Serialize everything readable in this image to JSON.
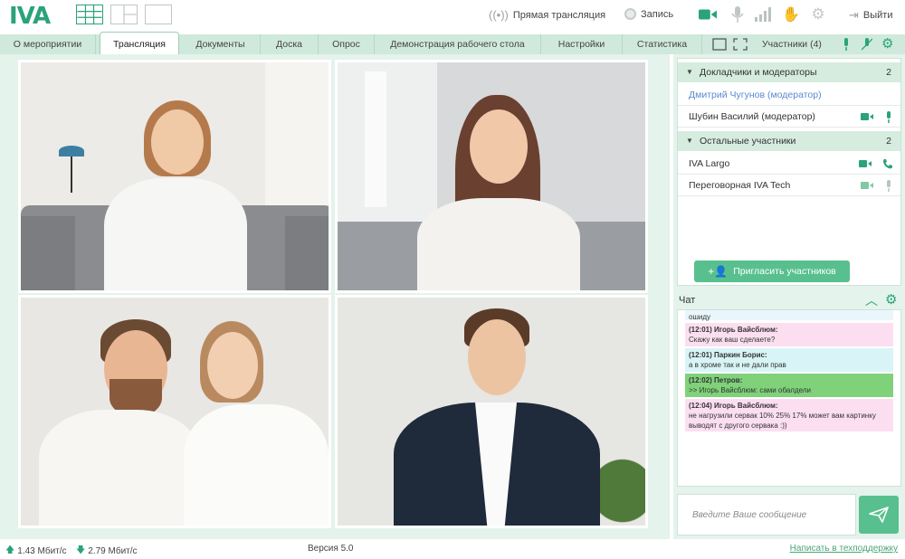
{
  "app": {
    "logo": "IVA"
  },
  "topbar": {
    "live_label": "Прямая трансляция",
    "record_label": "Запись",
    "exit_label": "Выйти"
  },
  "tabs": [
    {
      "label": "О мероприятии"
    },
    {
      "label": "Трансляция",
      "active": true
    },
    {
      "label": "Документы"
    },
    {
      "label": "Доска"
    },
    {
      "label": "Опрос"
    },
    {
      "label": "Демонстрация рабочего стола"
    },
    {
      "label": "Настройки"
    },
    {
      "label": "Статистика"
    }
  ],
  "participants_panel": {
    "title": "Участники (4)",
    "groups": [
      {
        "label": "Докладчики и модераторы",
        "count": "2",
        "members": [
          {
            "name": "Дмитрий Чугунов (модератор)"
          },
          {
            "name": "Шубин Василий (модератор)"
          }
        ]
      },
      {
        "label": "Остальные участники",
        "count": "2",
        "members": [
          {
            "name": "IVA Largo"
          },
          {
            "name": "Переговорная IVA Tech"
          }
        ]
      }
    ],
    "invite_label": "Пригласить участников"
  },
  "chat": {
    "title": "Чат",
    "messages": [
      {
        "author": "",
        "text": "ошиду",
        "color": "#e9f6fb"
      },
      {
        "author": "(12:01) Игорь Вайсблюм:",
        "text": "Скажу как ваш сделаете?",
        "color": "#fbdff0"
      },
      {
        "author": "(12:01) Паркин Борис:",
        "text": "а в хроме так и не дали прав",
        "color": "#d8f4f6"
      },
      {
        "author": "(12:02) Петров:",
        "text": ">> Игорь Вайсблюм: сами обалдели",
        "color": "#7fd27a"
      },
      {
        "author": "(12:04) Игорь Вайсблюм:",
        "text": "не нагрузили сервак 10% 25% 17% может вам картинку выводят с другого сервака :))",
        "color": "#fbdff0"
      }
    ],
    "input_placeholder": "Введите Ваше сообщение"
  },
  "status": {
    "upload": "1.43 Мбит/с",
    "download": "2.79 Мбит/с",
    "version": "Версия 5.0",
    "support_link": "Написать в техподдержку"
  },
  "colors": {
    "accent": "#2aa37a",
    "button_green": "#58c08e",
    "tab_bar": "#cfe9dc",
    "panel_bg": "#e4f3ec"
  }
}
